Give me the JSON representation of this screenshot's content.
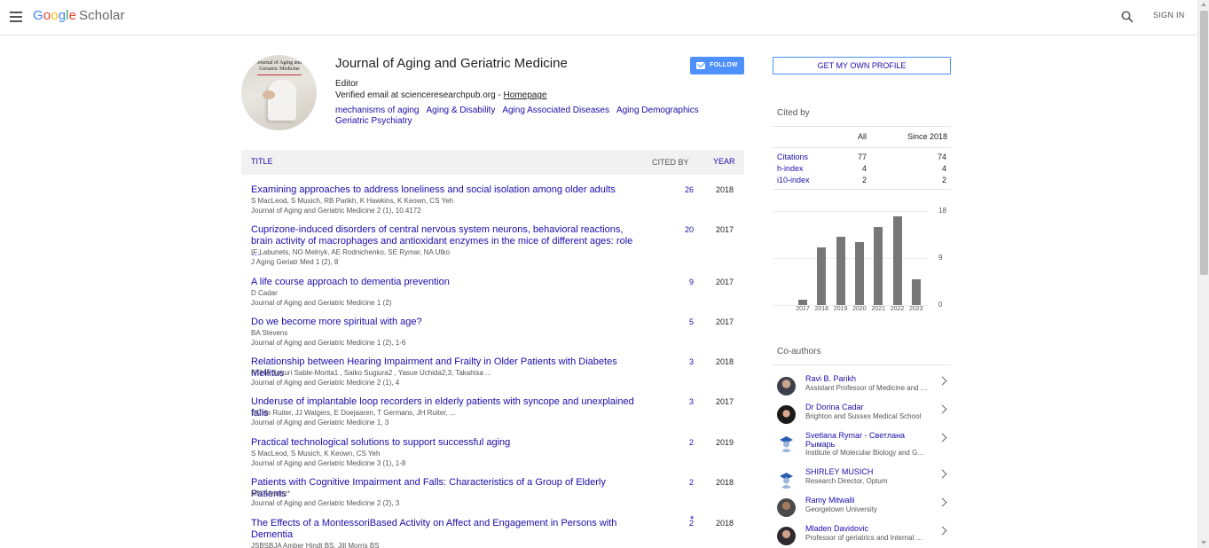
{
  "header": {
    "logo": {
      "g1": "G",
      "o1": "o",
      "o2": "o",
      "g2": "g",
      "l": "l",
      "e": "e",
      "scholar": "Scholar"
    },
    "sign_in": "SIGN IN",
    "icons": [
      "menu-icon",
      "search-icon"
    ]
  },
  "profile": {
    "cover_title": "Journal of Aging and Geriatric Medicine",
    "name": "Journal of Aging and Geriatric Medicine",
    "affiliation": "Editor",
    "verified_prefix": "Verified email at scienceresearchpub.org - ",
    "homepage": "Homepage",
    "interests": [
      "mechanisms of aging",
      "Aging & Disability",
      "Aging Associated Diseases",
      "Aging Demographics",
      "Geriatric Psychiatry"
    ],
    "follow": "FOLLOW"
  },
  "table": {
    "col_title": "TITLE",
    "col_cited": "CITED BY",
    "col_year": "YEAR",
    "rows": [
      {
        "title": "Examining approaches to address loneliness and social isolation among older adults",
        "authors": "S MacLeod, S Musich, RB Parikh, K Hawkins, K Keown, CS Yeh",
        "venue": "Journal of Aging and Geriatric Medicine 2 (1), 10.4172",
        "cited": "26",
        "year": "2018"
      },
      {
        "title": "Cuprizone-induced disorders of central nervous system neurons, behavioral reactions, brain activity of macrophages and antioxidant enzymes in the mice of different ages: role …",
        "authors": "IF Labunets, NO Melnyk, AE Rodnichenko, SE Rymar, NA Utko",
        "venue": "J Aging Geriatr Med 1 (2), 8",
        "cited": "20",
        "year": "2017"
      },
      {
        "title": "A life course approach to dementia prevention",
        "authors": "D Cadar",
        "venue": "Journal of Aging and Geriatric Medicine 1 (2)",
        "cited": "9",
        "year": "2017"
      },
      {
        "title": "Do we become more spiritual with age?",
        "authors": "BA Stevens",
        "venue": "Journal of Aging and Geriatric Medicine 1 (2), 1-6",
        "cited": "5",
        "year": "2017"
      },
      {
        "title": "Relationship between Hearing Impairment and Frailty in Older Patients with Diabetes Mellitus",
        "authors": "HTHA Sayuri Sable-Morita1 , Saiko Sugiura2 , Yasue Uchida2,3, Takahisa ...",
        "venue": "Journal of Aging and Geriatric Medicine 2 (1), 4",
        "cited": "3",
        "year": "2018"
      },
      {
        "title": "Underuse of implantable loop recorders in elderly patients with syncope and unexplained falls",
        "authors": "SC de Ruiter, JJ Walgers, E Doejaaren, T Germans, JH Ruiter, ...",
        "venue": "Journal of Aging and Geriatric Medicine 1, 3",
        "cited": "3",
        "year": "2017"
      },
      {
        "title": "Practical technological solutions to support successful aging",
        "authors": "S MacLeod, S Musich, K Keown, CS Yeh",
        "venue": "Journal of Aging and Geriatric Medicine 3 (1), 1-8",
        "cited": "2",
        "year": "2019"
      },
      {
        "title": "Patients with Cognitive Impairment and Falls: Characteristics of a Group of Elderly Patients",
        "authors": "MN Alvarez*",
        "venue": "Journal of Aging and Geriatric Medicine 2 (2), 3",
        "cited": "2",
        "year": "2018"
      },
      {
        "title": "The Effects of a MontessoriBased Activity on Affect and Engagement in Persons with Dementia",
        "authors": "JSBSBJA Amber Hindt BS, Jill Morris BS",
        "venue": "",
        "cited": "2",
        "star": "*",
        "year": "2018"
      }
    ]
  },
  "sidebar": {
    "own_profile": "GET MY OWN PROFILE",
    "cited_by": "Cited by",
    "col_all": "All",
    "col_since": "Since 2018",
    "metrics": [
      {
        "label": "Citations",
        "all": "77",
        "since": "74"
      },
      {
        "label": "h-index",
        "all": "4",
        "since": "4"
      },
      {
        "label": "i10-index",
        "all": "2",
        "since": "2"
      }
    ],
    "coauthors_title": "Co-authors",
    "coauthors": [
      {
        "name": "Ravi B. Parikh",
        "affil": "Assistant Professor of Medicine and Health Policy"
      },
      {
        "name": "Dr Dorina Cadar",
        "affil": "Brighton and Sussex Medical School"
      },
      {
        "name": "Svetlana Rymar - Светлана Рымарь",
        "affil": "Institute of Molecular Biology and Genetics"
      },
      {
        "name": "SHIRLEY MUSICH",
        "affil": "Research Director, Optum"
      },
      {
        "name": "Ramy Mitwalli",
        "affil": "Georgetown University"
      },
      {
        "name": "Mladen Davidovic",
        "affil": "Professor of geriatrics and Internal Medicine"
      }
    ]
  },
  "chart_data": {
    "type": "bar",
    "categories": [
      "2017",
      "2018",
      "2019",
      "2020",
      "2021",
      "2022",
      "2023"
    ],
    "values": [
      1,
      11,
      13,
      12,
      15,
      17,
      5
    ],
    "ylim": [
      0,
      18
    ],
    "yticks": [
      "18",
      "9",
      "0"
    ],
    "bar_color": "#777777"
  }
}
